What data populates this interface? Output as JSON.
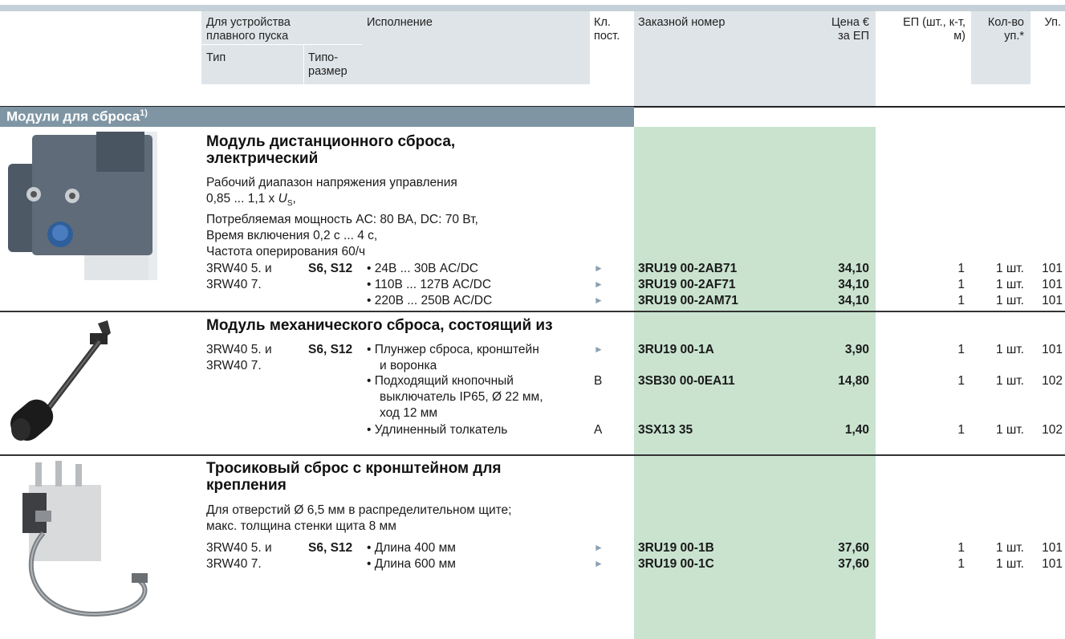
{
  "header": {
    "device": "Для устройства плавного пуска",
    "device_l1": "Для устройства",
    "device_l2": "плавного пуска",
    "type": "Тип",
    "size_l1": "Типо-",
    "size_l2": "размер",
    "version": "Исполнение",
    "class_l1": "Кл.",
    "class_l2": "пост.",
    "order": "Заказной номер",
    "price_l1": "Цена €",
    "price_l2": "за ЕП",
    "unit_l1": "ЕП (шт., к-т,",
    "unit_l2": "м)",
    "qty_l1": "Кол-во",
    "qty_l2": "уп.*",
    "pg": "Уп."
  },
  "section": {
    "title": "Модули для сброса",
    "footnote": "1)"
  },
  "block1": {
    "title_l1": "Модуль дистанционного сброса,",
    "title_l2": "электрический",
    "desc_l1": "Рабочий диапазон напряжения управления",
    "desc_l2_a": "0,85 ... 1,1 x ",
    "desc_l2_var": "U",
    "desc_l2_sub": "S",
    "desc_l2_b": ",",
    "desc_l3": "Потребляемая мощность AC: 80 ВА, DC: 70 Вт,",
    "desc_l4": "Время включения 0,2 с ... 4 с,",
    "desc_l5": "Частота оперирования 60/ч",
    "type_l1": "3RW40 5. и",
    "type_l2": "3RW40 7.",
    "size": "S6, S12",
    "rows": [
      {
        "version": "• 24В ... 30В AC/DC",
        "class": "►",
        "order": "3RU19 00-2AB71",
        "price": "34,10",
        "unit": "1",
        "qty": "1 шт.",
        "pg": "101"
      },
      {
        "version": "• 110В ... 127В AC/DC",
        "class": "►",
        "order": "3RU19 00-2AF71",
        "price": "34,10",
        "unit": "1",
        "qty": "1 шт.",
        "pg": "101"
      },
      {
        "version": "• 220В ... 250В AC/DC",
        "class": "►",
        "order": "3RU19 00-2AM71",
        "price": "34,10",
        "unit": "1",
        "qty": "1 шт.",
        "pg": "101"
      }
    ]
  },
  "block2": {
    "title": "Модуль механического сброса, состоящий из",
    "type_l1": "3RW40 5. и",
    "type_l2": "3RW40 7.",
    "size": "S6, S12",
    "rows": [
      {
        "version_l1": "• Плунжер сброса, кронштейн",
        "version_l2": "и воронка",
        "version_l3": "",
        "class": "►",
        "order": "3RU19 00-1A",
        "price": "3,90",
        "unit": "1",
        "qty": "1 шт.",
        "pg": "101"
      },
      {
        "version_l1": "• Подходящий кнопочный",
        "version_l2": "выключатель IP65, Ø 22 мм,",
        "version_l3": "ход 12 мм",
        "class": "B",
        "order": "3SB30 00-0EA11",
        "price": "14,80",
        "unit": "1",
        "qty": "1 шт.",
        "pg": "102"
      },
      {
        "version_l1": "• Удлиненный толкатель",
        "version_l2": "",
        "version_l3": "",
        "class": "A",
        "order": "3SX13 35",
        "price": "1,40",
        "unit": "1",
        "qty": "1 шт.",
        "pg": "102"
      }
    ]
  },
  "block3": {
    "title_l1": "Тросиковый сброс с кронштейном для",
    "title_l2": "крепления",
    "desc_l1": "Для отверстий Ø 6,5 мм в распределительном щите;",
    "desc_l2": "макс. толщина стенки щита 8 мм",
    "type_l1": "3RW40 5. и",
    "type_l2": "3RW40 7.",
    "size": "S6, S12",
    "rows": [
      {
        "version": "• Длина 400 мм",
        "class": "►",
        "order": "3RU19 00-1B",
        "price": "37,60",
        "unit": "1",
        "qty": "1 шт.",
        "pg": "101"
      },
      {
        "version": "• Длина 600 мм",
        "class": "►",
        "order": "3RU19 00-1C",
        "price": "37,60",
        "unit": "1",
        "qty": "1 шт.",
        "pg": "101"
      }
    ]
  }
}
